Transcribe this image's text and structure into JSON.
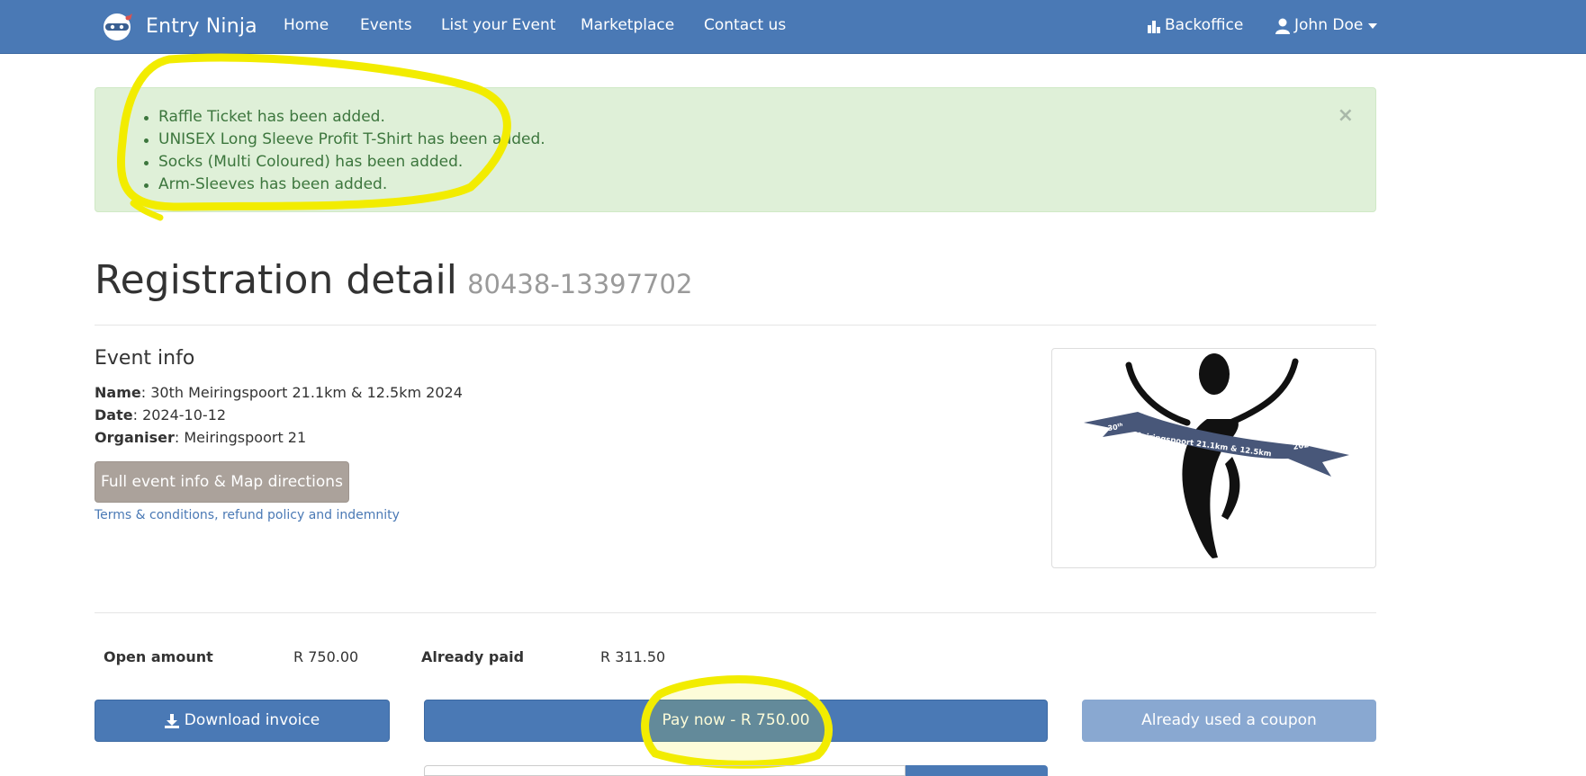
{
  "navbar": {
    "brand": "Entry Ninja",
    "links": [
      "Home",
      "Events",
      "List your Event",
      "Marketplace",
      "Contact us"
    ],
    "backoffice": "Backoffice",
    "user": "John Doe"
  },
  "alert": {
    "items": [
      "Raffle Ticket has been added.",
      "UNISEX Long Sleeve Profit T-Shirt has been added.",
      "Socks (Multi Coloured) has been added.",
      "Arm-Sleeves has been added."
    ],
    "close": "×"
  },
  "page": {
    "title": "Registration detail",
    "reference": "80438-13397702"
  },
  "event": {
    "heading": "Event info",
    "name_label": "Name",
    "name": "30th Meiringspoort 21.1km & 12.5km 2024",
    "date_label": "Date",
    "date": "2024-10-12",
    "organiser_label": "Organiser",
    "organiser": "Meiringspoort 21",
    "info_button": "Full event info & Map directions",
    "terms_link": "Terms & conditions, refund policy and indemnity",
    "logo": {
      "edition": "30",
      "edition_suffix": "th",
      "banner_text": "Meiringspoort 21.1km & 12.5km",
      "year": "2024"
    }
  },
  "payment": {
    "open_label": "Open amount",
    "open_value": "R 750.00",
    "paid_label": "Already paid",
    "paid_value": "R 311.50",
    "download_button": "Download invoice",
    "pay_button": "Pay now - R 750.00",
    "coupon_button": "Already used a coupon"
  },
  "colors": {
    "navbar": "#4a79b5",
    "alert_bg": "#dff0d8",
    "alert_text": "#3c763d",
    "highlight": "#f2ec00",
    "grey_button": "#aba29b"
  },
  "icons": {
    "brand": "ninja-icon",
    "backoffice": "bar-chart-icon",
    "user": "user-icon",
    "download": "download-icon"
  }
}
